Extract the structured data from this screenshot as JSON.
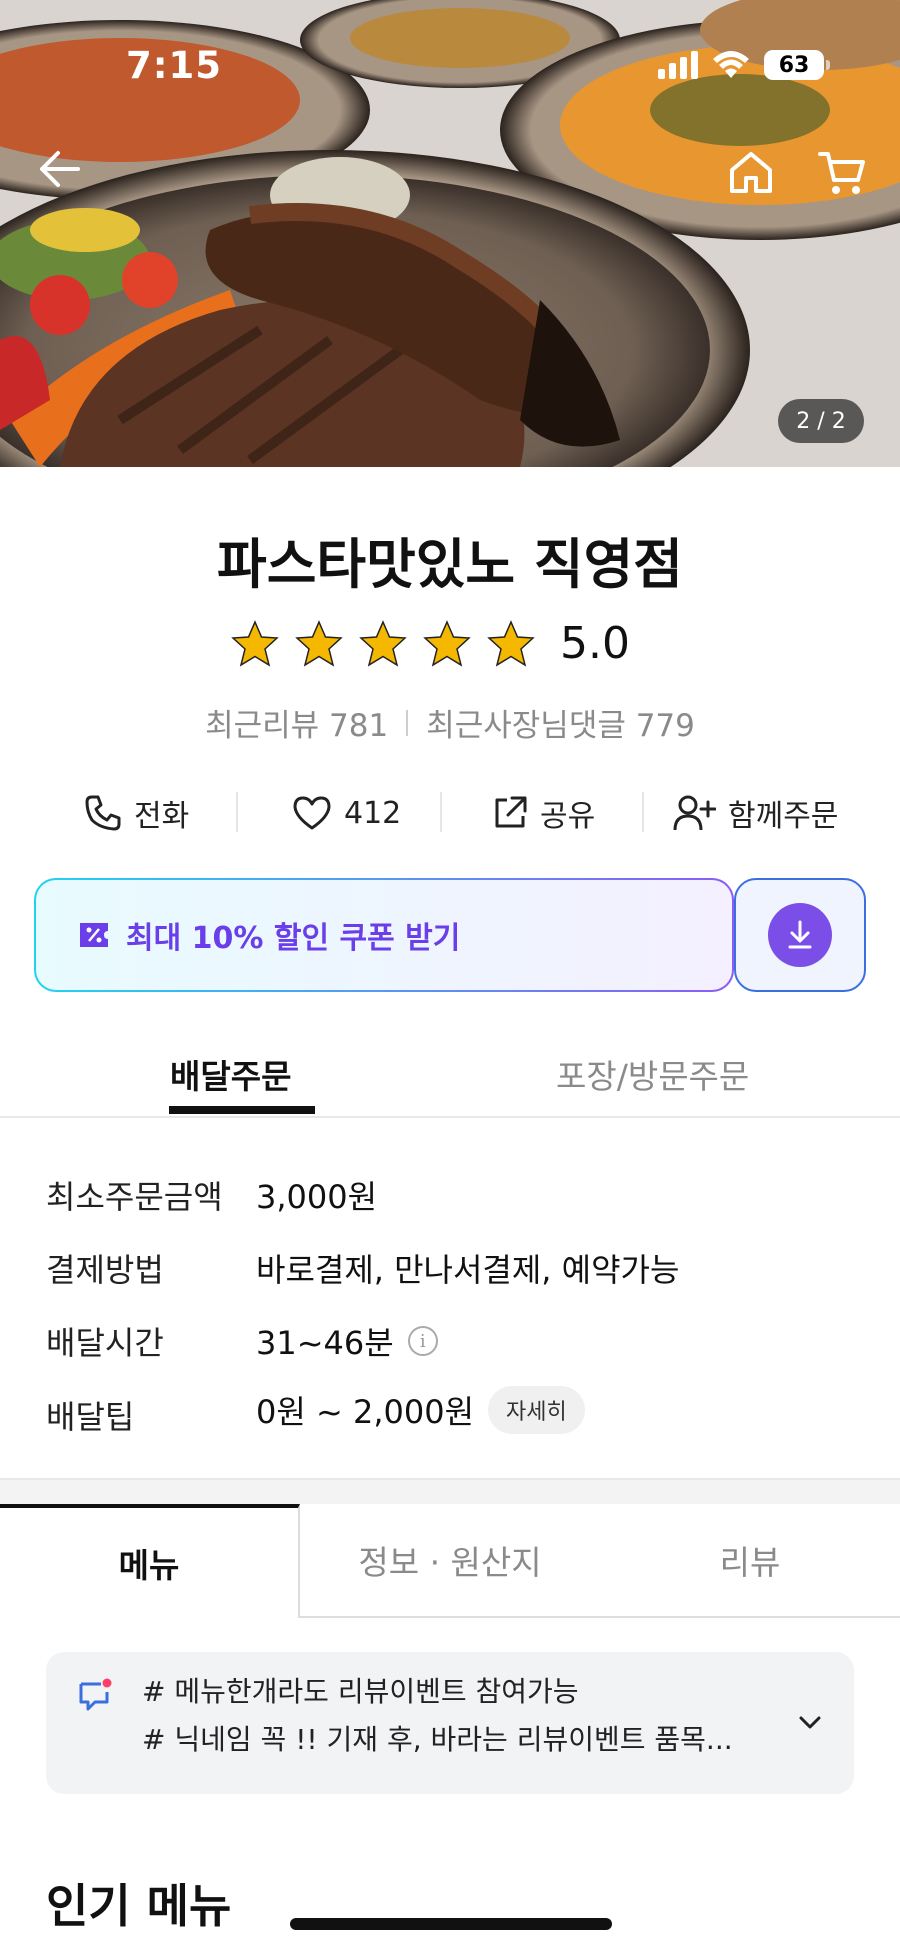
{
  "status_bar": {
    "time": "7:15",
    "battery": "63"
  },
  "hero": {
    "page_counter": "2 / 2"
  },
  "store": {
    "name": "파스타맛있노 직영점",
    "rating": "5.0",
    "star_count": 5,
    "recent_reviews": "최근리뷰 781",
    "owner_replies": "최근사장님댓글 779"
  },
  "actions": {
    "call": "전화",
    "likes": "412",
    "share": "공유",
    "group_order": "함께주문"
  },
  "coupon": {
    "label": "최대 10% 할인 쿠폰 받기"
  },
  "order_tabs": {
    "delivery": "배달주문",
    "pickup": "포장/방문주문"
  },
  "details": [
    {
      "label": "최소주문금액",
      "value": "3,000원"
    },
    {
      "label": "결제방법",
      "value": "바로결제, 만나서결제, 예약가능"
    },
    {
      "label": "배달시간",
      "value": "31~46분"
    },
    {
      "label": "배달팁",
      "value": "0원 ~ 2,000원",
      "button": "자세히"
    }
  ],
  "menu_tabs": {
    "menu": "메뉴",
    "info": "정보 · 원산지",
    "review": "리뷰"
  },
  "notice": {
    "line1": "# 메뉴한개라도 리뷰이벤트 참여가능",
    "line2": "# 닉네임 꼭 !! 기재 후, 바라는 리뷰이벤트 품목..."
  },
  "section": {
    "popular_menu": "인기 메뉴"
  },
  "colors": {
    "accent_purple": "#7b4ee8",
    "coupon_blue": "#3b6fe0",
    "star": "#f5b800"
  }
}
